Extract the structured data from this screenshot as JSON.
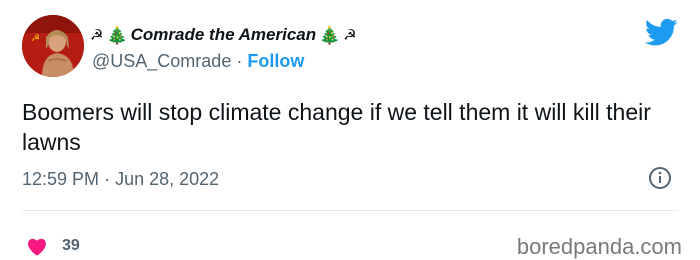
{
  "author": {
    "display_name": "Comrade the American",
    "leading_emojis": [
      "☭",
      "🎄"
    ],
    "trailing_emojis": [
      "🎄",
      "☭"
    ],
    "handle": "@USA_Comrade",
    "separator": "·",
    "follow_label": "Follow",
    "avatar_icon": "avatar-photo"
  },
  "tweet": {
    "text": "Boomers will stop climate change if we tell them it will kill their lawns",
    "time": "12:59 PM",
    "separator": "·",
    "date": "Jun 28, 2022"
  },
  "engagement": {
    "likes": "39",
    "heart_color": "#f91880"
  },
  "watermark": "boredpanda.com",
  "colors": {
    "brand_blue": "#1d9bf0",
    "secondary_text": "#536471",
    "primary_text": "#0f1419"
  },
  "icons": [
    "twitter-bird-icon",
    "info-icon",
    "heart-icon"
  ]
}
